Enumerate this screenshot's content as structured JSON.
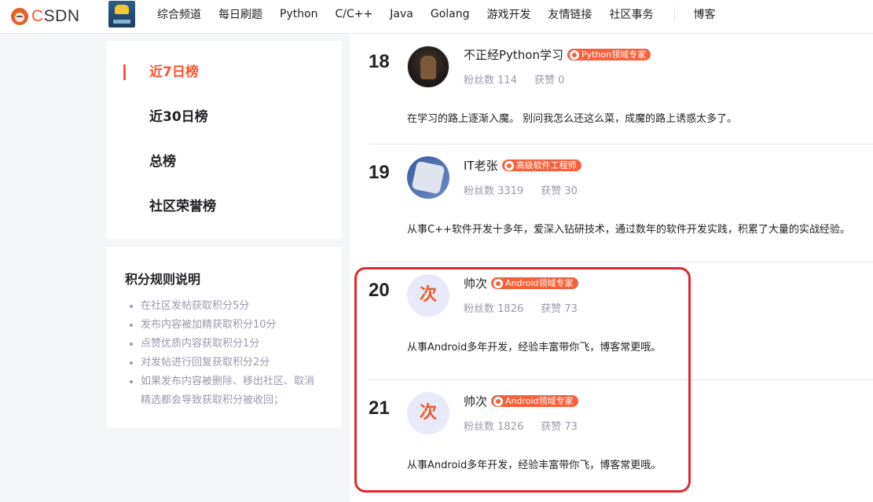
{
  "logo": {
    "text_pre": "C",
    "text_post": "SDN"
  },
  "nav": {
    "items": [
      "综合频道",
      "每日刷题",
      "Python",
      "C/C++",
      "Java",
      "Golang",
      "游戏开发",
      "友情链接",
      "社区事务"
    ],
    "blog": "博客"
  },
  "menu": {
    "items": [
      "近7日榜",
      "近30日榜",
      "总榜",
      "社区荣誉榜"
    ],
    "active_index": 0
  },
  "rules": {
    "title": "积分规则说明",
    "items": [
      "在社区发帖获取积分5分",
      "发布内容被加精获取积分10分",
      "点赞优质内容获取积分1分",
      "对发帖进行回复获取积分2分",
      "如果发布内容被删除、移出社区、取消精选都会导致获取积分被收回；"
    ]
  },
  "entries": [
    {
      "rank": "18",
      "name": "不正经Python学习",
      "badge": "Python领域专家",
      "fans_label": "粉丝数",
      "fans": "114",
      "likes_label": "获赞",
      "likes": "0",
      "desc": "在学习的路上逐渐入魔。 别问我怎么还这么菜，成魔的路上诱惑太多了。",
      "avatar": "dark-figure-avatar"
    },
    {
      "rank": "19",
      "name": "IT老张",
      "badge": "高级软件工程师",
      "fans_label": "粉丝数",
      "fans": "3319",
      "likes_label": "获赞",
      "likes": "30",
      "desc": "从事C++软件开发十多年，爱深入钻研技术，通过数年的软件开发实践，积累了大量的实战经验。",
      "avatar": "cube-avatar"
    },
    {
      "rank": "20",
      "name": "帅次",
      "badge": "Android领域专家",
      "fans_label": "粉丝数",
      "fans": "1826",
      "likes_label": "获赞",
      "likes": "73",
      "desc": "从事Android多年开发，经验丰富带你飞，博客常更哦。",
      "avatar": "ci-avatar",
      "avatar_char": "次"
    },
    {
      "rank": "21",
      "name": "帅次",
      "badge": "Android领域专家",
      "fans_label": "粉丝数",
      "fans": "1826",
      "likes_label": "获赞",
      "likes": "73",
      "desc": "从事Android多年开发，经验丰富带你飞，博客常更哦。",
      "avatar": "ci-avatar",
      "avatar_char": "次"
    }
  ],
  "colors": {
    "accent": "#fc5531",
    "highlight": "#e3272f"
  }
}
